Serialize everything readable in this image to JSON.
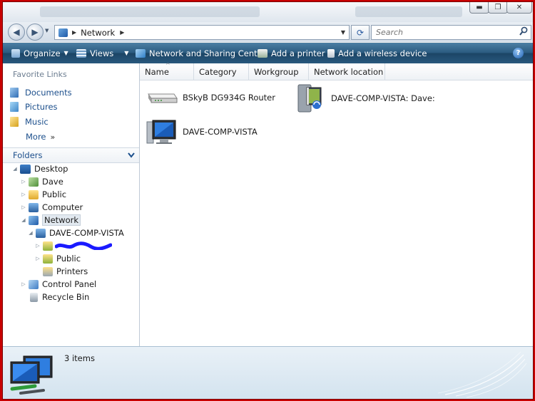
{
  "window": {
    "minimize_glyph": "▬",
    "maximize_glyph": "❐",
    "close_glyph": "✕"
  },
  "address_bar": {
    "back_glyph": "◀",
    "forward_glyph": "▶",
    "location": "Network",
    "refresh_glyph": "⟳",
    "search_placeholder": "Search"
  },
  "toolbar": {
    "organize": "Organize",
    "views": "Views",
    "network_sharing": "Network and Sharing Center",
    "add_printer": "Add a printer",
    "add_wireless": "Add a wireless device",
    "help_glyph": "?"
  },
  "favorites": {
    "title": "Favorite Links",
    "items": [
      "Documents",
      "Pictures",
      "Music"
    ],
    "more": "More"
  },
  "folders": {
    "title": "Folders",
    "tree": {
      "desktop": "Desktop",
      "dave": "Dave",
      "public": "Public",
      "computer": "Computer",
      "network": "Network",
      "dave_comp_vista": "DAVE-COMP-VISTA",
      "share_public": "Public",
      "printers": "Printers",
      "control_panel": "Control Panel",
      "recycle_bin": "Recycle Bin"
    }
  },
  "columns": [
    "Name",
    "Category",
    "Workgroup",
    "Network location"
  ],
  "items": {
    "router": "BSkyB DG934G Router",
    "media": "DAVE-COMP-VISTA: Dave:",
    "computer": "DAVE-COMP-VISTA"
  },
  "details": {
    "count": "3 items"
  },
  "colors": {
    "outer_border": "#c80000",
    "toolbar": "#2b5b80",
    "link": "#1c4f8c"
  }
}
